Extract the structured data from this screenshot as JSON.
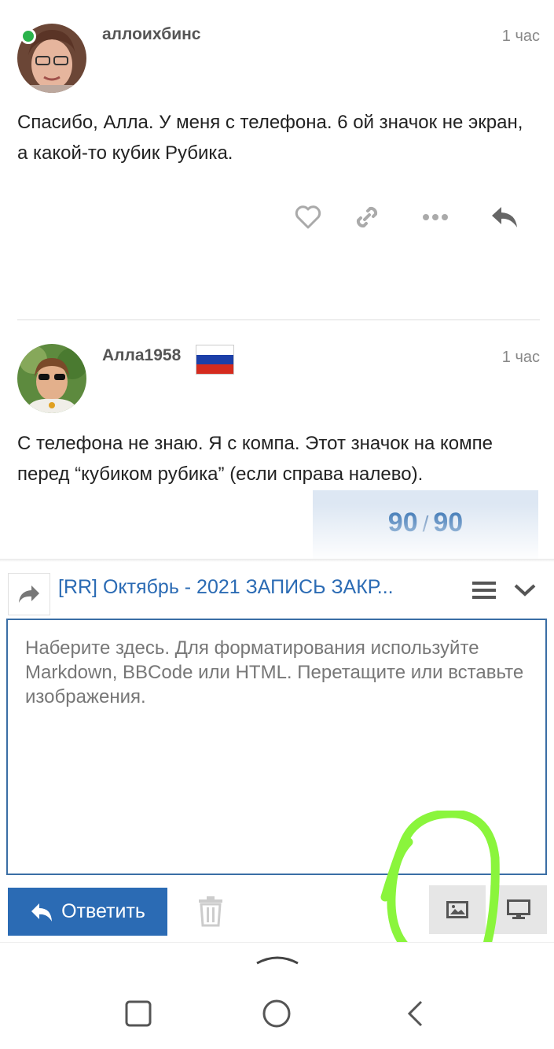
{
  "posts": [
    {
      "username": "аллоихбинс",
      "time": "1 час",
      "text": "Спасибо, Алла. У меня с телефона. 6 ой значок не экран, а какой-то кубик Рубика.",
      "online": true
    },
    {
      "username": "Алла1958",
      "time": "1 час",
      "text": "С телефона не знаю. Я с компа. Этот значок на компе перед “кубиком рубика” (если справа налево).",
      "flag": "russia-flag"
    }
  ],
  "progress": {
    "current": "90",
    "separator": "/",
    "total": "90"
  },
  "composer": {
    "topic_title": "[RR] Октябрь - 2021 ЗАПИСЬ ЗАКР...",
    "placeholder": "Наберите здесь. Для форматирования используйте Markdown, BBCode или HTML. Перетащите или вставьте изображения.",
    "reply_label": "Ответить"
  },
  "icons": {
    "like": "heart-icon",
    "link": "link-icon",
    "more": "ellipsis-icon",
    "reply": "reply-icon",
    "upload": "image-icon",
    "preview": "desktop-icon",
    "trash": "trash-icon"
  },
  "colors": {
    "accent": "#2b6bb4",
    "online": "#2ab34b",
    "annotation": "#8af53c"
  }
}
